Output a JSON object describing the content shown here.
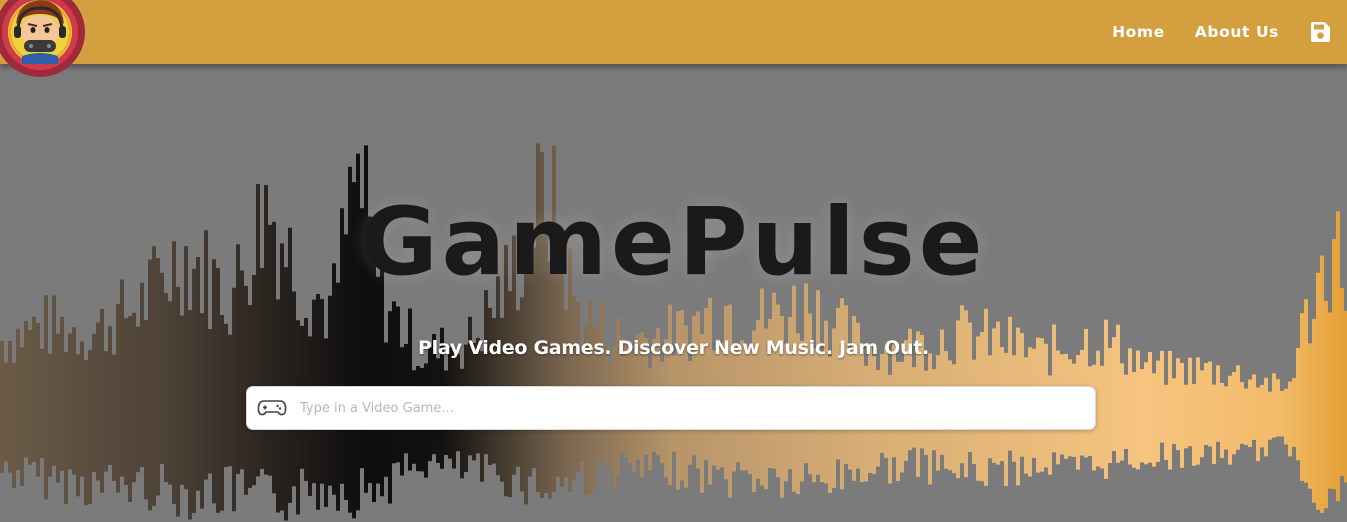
{
  "header": {
    "nav": [
      {
        "label": "Home"
      },
      {
        "label": "About Us"
      }
    ],
    "save_icon": "floppy-disk-icon",
    "logo_icon": "gamer-mascot-logo"
  },
  "hero": {
    "title": "GamePulse",
    "subtitle": "Play Video Games. Discover New Music. Jam Out.",
    "search": {
      "placeholder": "Type in a Video Game...",
      "value": "",
      "icon": "gamepad-icon"
    }
  },
  "colors": {
    "navbar": "#d4a03f",
    "background": "#7b7b7b",
    "title": "#1a1a1a",
    "wave_dark": "#141414",
    "wave_light": "#f5c27a",
    "wave_edge": "#e8a33c"
  }
}
